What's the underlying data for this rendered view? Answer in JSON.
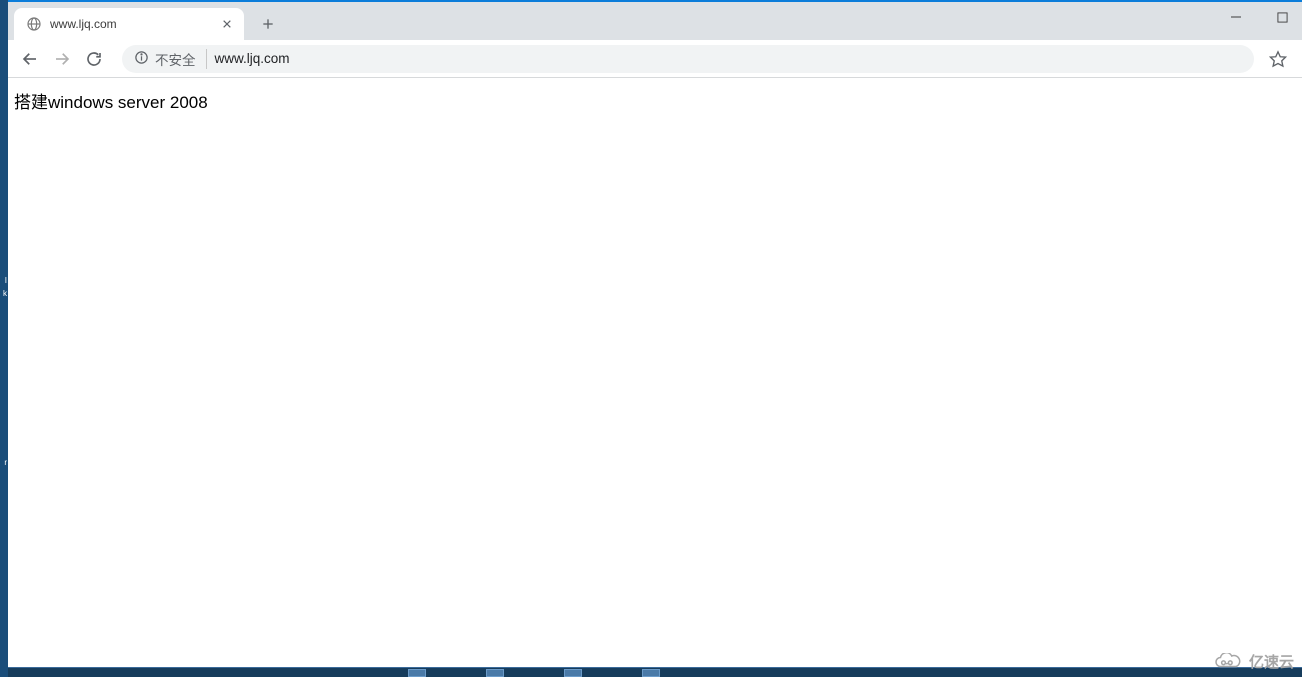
{
  "tab": {
    "title": "www.ljq.com"
  },
  "addressbar": {
    "security_label": "不安全",
    "url": "www.ljq.com"
  },
  "page": {
    "heading": "搭建windows server 2008"
  },
  "watermark": {
    "text": "亿速云"
  },
  "desktop_text": {
    "frag1": "I",
    "frag2": "k",
    "frag3": "r"
  }
}
